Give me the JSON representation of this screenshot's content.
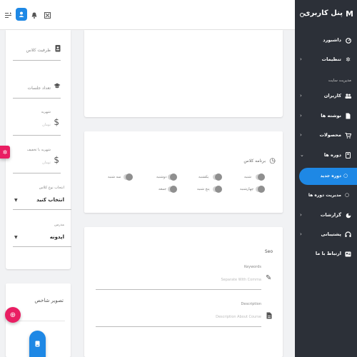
{
  "sidebar": {
    "title": "پنل کاربری",
    "logo": "M",
    "section_label": "مدیریت سایت",
    "items": [
      {
        "label": "داشبورد",
        "icon": "dashboard-icon",
        "chevron": ""
      },
      {
        "label": "تنظیمات",
        "icon": "gear-icon",
        "chevron": "‹"
      },
      {
        "label": "کاربران",
        "icon": "users-icon",
        "chevron": "‹"
      },
      {
        "label": "نوشته ها",
        "icon": "document-icon",
        "chevron": "‹"
      },
      {
        "label": "محصولات",
        "icon": "cart-icon",
        "chevron": "‹"
      },
      {
        "label": "دوره ها",
        "icon": "book-icon",
        "chevron": "⌄"
      },
      {
        "label": "گزارشات",
        "icon": "report-icon",
        "chevron": "‹"
      },
      {
        "label": "پشتیبانی",
        "icon": "headset-icon",
        "chevron": "‹"
      },
      {
        "label": "ارتباط با ما",
        "icon": "contact-icon",
        "chevron": ""
      }
    ],
    "subitems": [
      {
        "label": "دوره جدید",
        "bullet": "○"
      },
      {
        "label": "مدیریت دوره ها",
        "bullet": "○"
      }
    ]
  },
  "form": {
    "capacity_label": "ظرفیت کلاس",
    "sessions_label": "تعداد جلسات",
    "tuition_label": "شهریه",
    "tuition_hint": "تومان",
    "discount_label": "شهریه با تخفیف",
    "discount_hint": "تومان",
    "class_type_label": "انتخاب نوع کلاس",
    "class_type_value": "انتخاب کنید",
    "teacher_label": "مدرس",
    "teacher_value": "اپدونه",
    "image_title": "تصویر شاخص"
  },
  "schedule": {
    "title": "برنامه کلاس",
    "days": [
      "شنبه",
      "یکشنبه",
      "دوشنبه",
      "سه شنبه",
      "چهارشنبه",
      "پنج شنبه",
      "جمعه"
    ]
  },
  "seo": {
    "title": "Seo",
    "keywords_label": "Keywords",
    "keywords_placeholder": "Separate With Comma",
    "description_label": "Description",
    "description_placeholder": "Description About Course"
  }
}
